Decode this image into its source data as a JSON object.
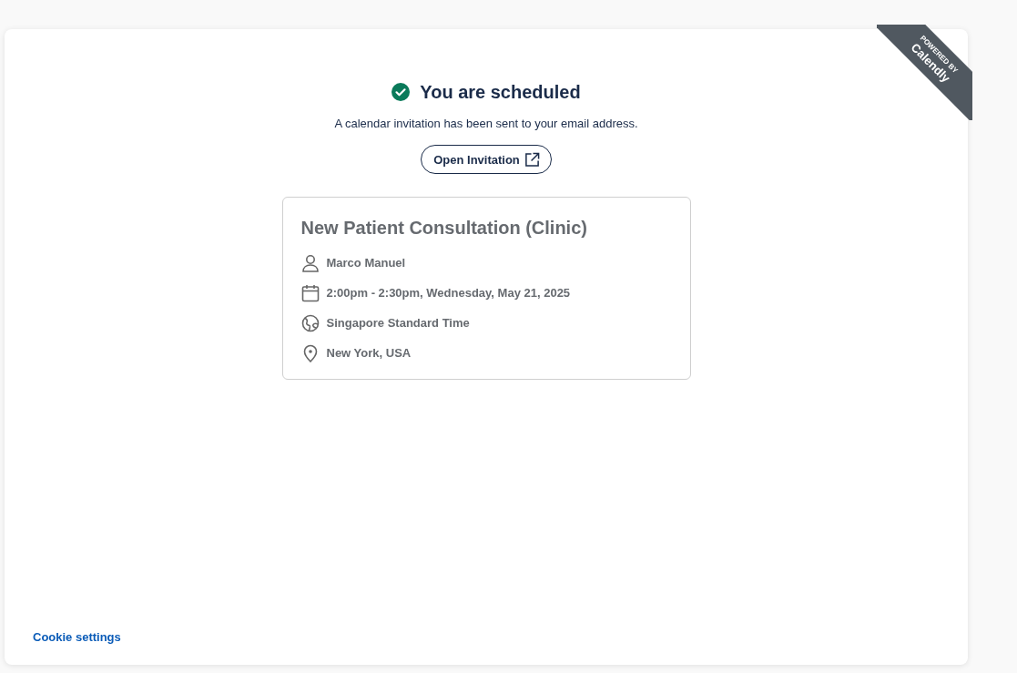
{
  "ribbon": {
    "line_1": "POWERED BY",
    "line_2": "Calendly"
  },
  "header": {
    "title": "You are scheduled",
    "message": "A calendar invitation has been sent to your email address.",
    "button": "Open Invitation"
  },
  "event": {
    "title": "New Patient Consultation (Clinic)",
    "details": [
      {
        "kind": "person",
        "text": "Marco Manuel"
      },
      {
        "kind": "calendar",
        "text": "2:00pm - 2:30pm, Wednesday, May 21, 2025"
      },
      {
        "kind": "globe",
        "text": "Singapore Standard Time"
      },
      {
        "kind": "location",
        "text": "New York, USA"
      }
    ]
  },
  "footer": {
    "link": "Cookie settings"
  }
}
